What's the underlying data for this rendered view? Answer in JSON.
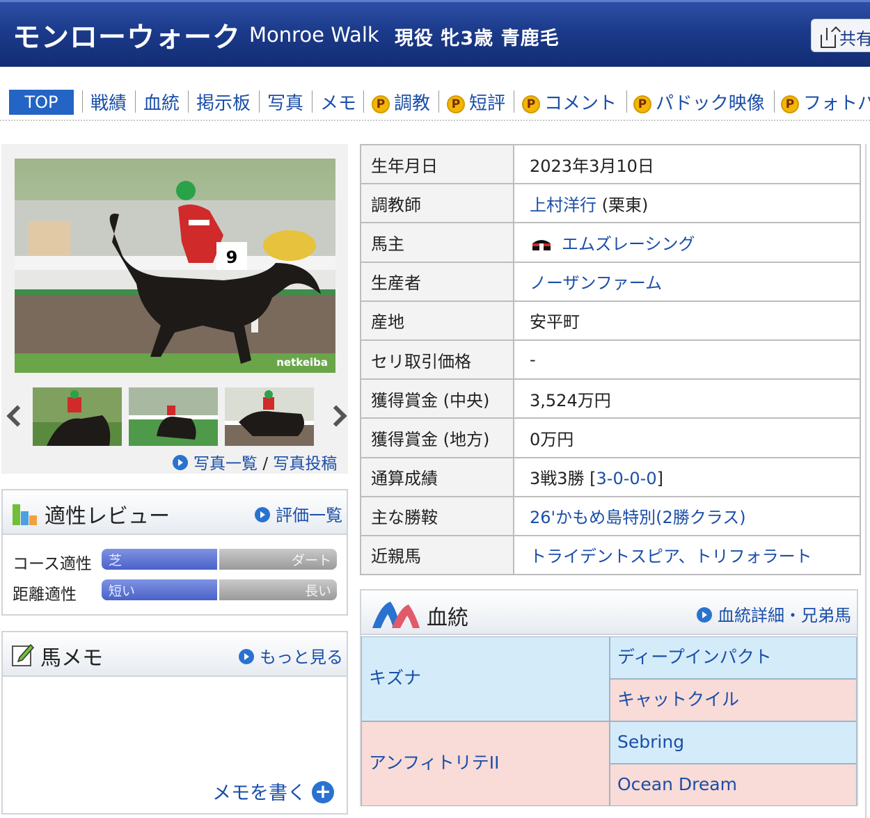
{
  "header": {
    "jp_name": "モンローウォーク",
    "en_name": "Monroe Walk",
    "profile": "現役 牝3歳 青鹿毛",
    "share_label": "共有"
  },
  "nav": {
    "items": [
      "TOP",
      "戦績",
      "血統",
      "掲示板",
      "写真",
      "メモ",
      "調教",
      "短評",
      "コメント",
      "パドック映像",
      "フォトパ"
    ],
    "premium_badge": "P"
  },
  "photos": {
    "watermark": "netkeiba",
    "saddle_number": "9",
    "list_link": "写真一覧",
    "separator": "/",
    "post_link": "写真投稿"
  },
  "aptitude": {
    "title": "適性レビュー",
    "link": "評価一覧",
    "rows": [
      {
        "label": "コース適性",
        "left": "芝",
        "right": "ダート",
        "value": 0.5
      },
      {
        "label": "距離適性",
        "left": "短い",
        "right": "長い",
        "value": 0.5
      }
    ]
  },
  "memo": {
    "title": "馬メモ",
    "link": "もっと見る",
    "write": "メモを書く",
    "plus": "+"
  },
  "info": {
    "birth_label": "生年月日",
    "birth": "2023年3月10日",
    "trainer_label": "調教師",
    "trainer": "上村洋行",
    "trainer_area": "(栗東)",
    "owner_label": "馬主",
    "owner": "エムズレーシング",
    "breeder_label": "生産者",
    "breeder": "ノーザンファーム",
    "origin_label": "産地",
    "origin": "安平町",
    "auction_label": "セリ取引価格",
    "auction": "-",
    "prize_central_label": "獲得賞金 (中央)",
    "prize_central": "3,524万円",
    "prize_local_label": "獲得賞金 (地方)",
    "prize_local": "0万円",
    "record_label": "通算成績",
    "record_prefix": "3戦3勝 [",
    "record_link": "3-0-0-0",
    "record_suffix": "]",
    "main_win_label": "主な勝鞍",
    "main_win": "26'かもめ島特別(2勝クラス)",
    "relatives_label": "近親馬",
    "relative_1": "トライデントスピア",
    "relative_sep": "、",
    "relative_2": "トリフォラート"
  },
  "pedigree": {
    "title": "血統",
    "link": "血統詳細・兄弟馬",
    "sire": "キズナ",
    "dam": "アンフィトリテII",
    "sire_sire": "ディープインパクト",
    "sire_dam": "キャットクイル",
    "dam_sire": "Sebring",
    "dam_dam": "Ocean Dream"
  },
  "colors": {
    "header_bg": "#1b3a8a",
    "link": "#1a4ea8",
    "pedigree_male": "#d4ecfa",
    "pedigree_female": "#f9dbd7"
  }
}
